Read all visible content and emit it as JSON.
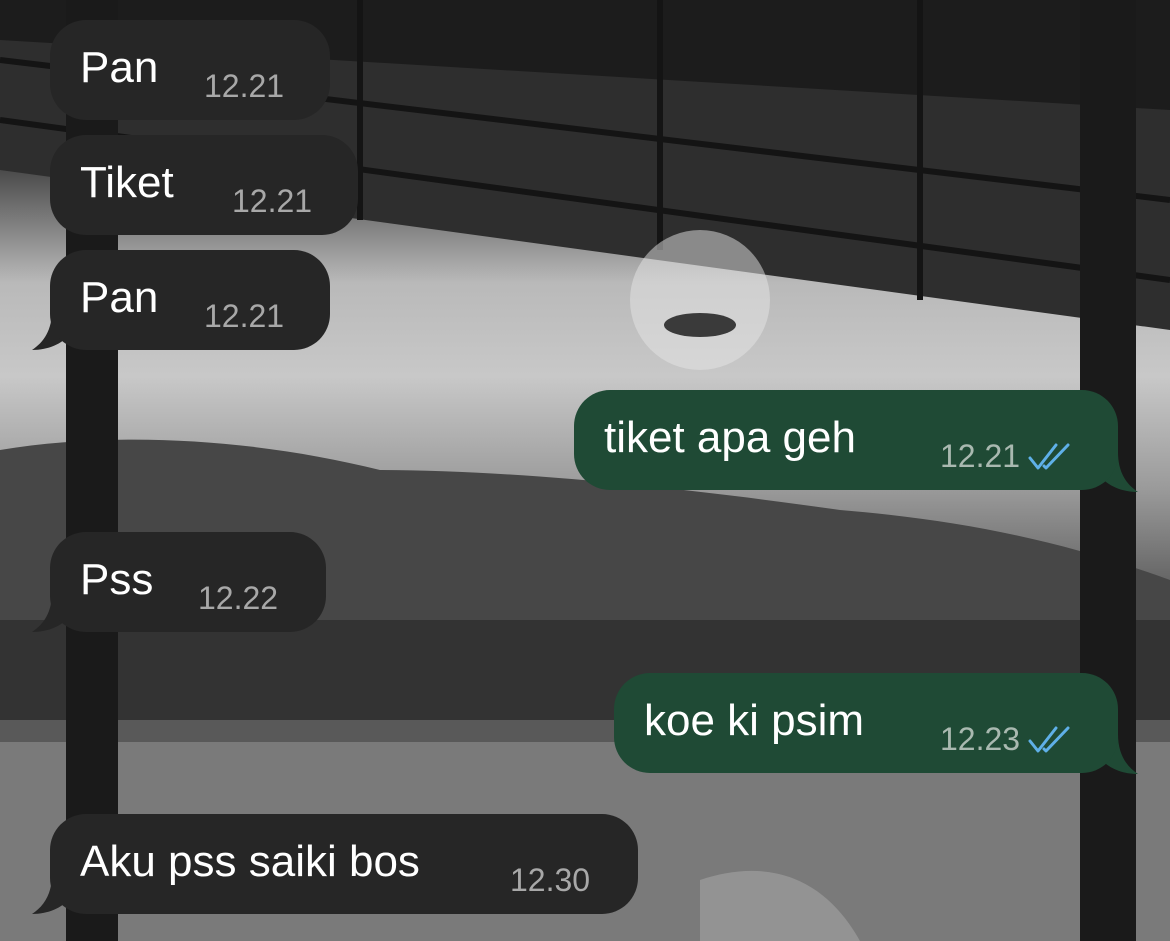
{
  "colors": {
    "incoming_bubble": "#262626",
    "outgoing_bubble": "#1f4a35",
    "read_receipt": "#5fb0e8"
  },
  "messages": [
    {
      "direction": "incoming",
      "text": "Pan",
      "time": "12.21"
    },
    {
      "direction": "incoming",
      "text": "Tiket",
      "time": "12.21"
    },
    {
      "direction": "incoming",
      "text": "Pan",
      "time": "12.21"
    },
    {
      "direction": "outgoing",
      "text": "tiket apa geh",
      "time": "12.21",
      "status_icon": "double-check-icon"
    },
    {
      "direction": "incoming",
      "text": "Pss",
      "time": "12.22"
    },
    {
      "direction": "outgoing",
      "text": "koe ki psim",
      "time": "12.23",
      "status_icon": "double-check-icon"
    },
    {
      "direction": "incoming",
      "text": "Aku pss saiki bos",
      "time": "12.30"
    }
  ]
}
